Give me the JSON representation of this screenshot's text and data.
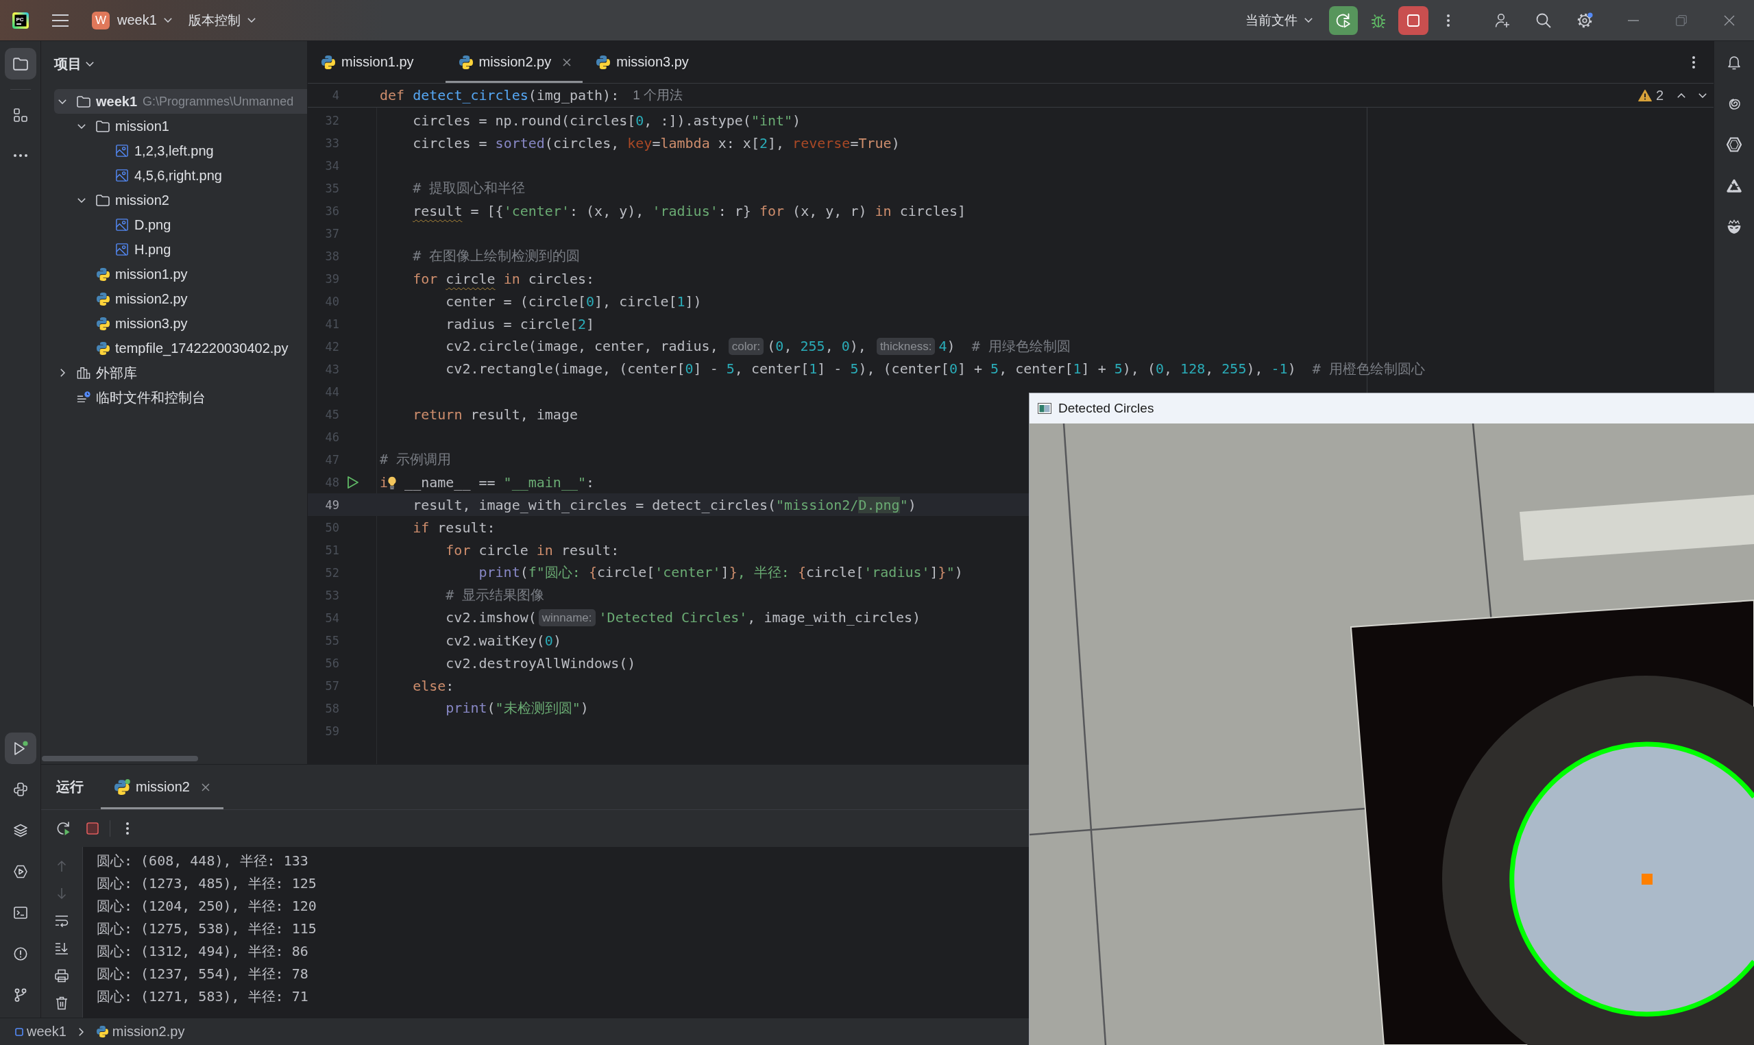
{
  "title_bar": {
    "logo": "PC",
    "project_initial": "W",
    "project": "week1",
    "vcs_menu": "版本控制",
    "run_config": "当前文件"
  },
  "tool_strip": {
    "top": [
      {
        "kind": "project",
        "selected": true
      },
      {
        "kind": "structure",
        "selected": false
      },
      {
        "kind": "more",
        "selected": false
      }
    ],
    "bottom": [
      {
        "kind": "run",
        "selected": true
      },
      {
        "kind": "python_console",
        "selected": false
      },
      {
        "kind": "packages",
        "selected": false
      },
      {
        "kind": "services",
        "selected": false
      },
      {
        "kind": "terminal",
        "selected": false
      },
      {
        "kind": "problems",
        "selected": false
      },
      {
        "kind": "git",
        "selected": false
      }
    ]
  },
  "project_panel": {
    "title": "项目",
    "tree": [
      {
        "kind": "folder",
        "name": "week1",
        "path": "G:\\Programmes\\Unmanned",
        "expanded": true,
        "selected": true,
        "children": [
          {
            "kind": "folder",
            "name": "mission1",
            "expanded": true,
            "selected": false,
            "children": [
              {
                "kind": "image",
                "name": "1,2,3,left.png",
                "selected": false
              },
              {
                "kind": "image",
                "name": "4,5,6,right.png",
                "selected": false
              }
            ]
          },
          {
            "kind": "folder",
            "name": "mission2",
            "expanded": true,
            "selected": false,
            "children": [
              {
                "kind": "image",
                "name": "D.png",
                "selected": false
              },
              {
                "kind": "image",
                "name": "H.png",
                "selected": false
              }
            ]
          },
          {
            "kind": "python",
            "name": "mission1.py",
            "selected": false
          },
          {
            "kind": "python",
            "name": "mission2.py",
            "selected": false
          },
          {
            "kind": "python",
            "name": "mission3.py",
            "selected": false
          },
          {
            "kind": "python",
            "name": "tempfile_1742220030402.py",
            "selected": false
          }
        ]
      },
      {
        "kind": "library",
        "name": "外部库",
        "expanded": false,
        "selected": false
      },
      {
        "kind": "scratches",
        "name": "临时文件和控制台",
        "selected": false
      }
    ]
  },
  "editor": {
    "tabs": [
      {
        "label": "mission1.py",
        "selected": false
      },
      {
        "label": "mission2.py",
        "selected": true
      },
      {
        "label": "mission3.py",
        "selected": false
      }
    ],
    "sticky_line": {
      "number": "4",
      "tokens": [
        {
          "kind": "keyword",
          "text": "def "
        },
        {
          "kind": "function",
          "text": "detect_circles"
        },
        {
          "kind": "plain",
          "text": "(img_path):"
        }
      ],
      "usages": "1 个用法"
    },
    "problems": "2",
    "lines": [
      {
        "n": "32",
        "current": false,
        "run_marker": false,
        "tokens": [
          {
            "kind": "plain",
            "text": "    circles = np.round(circles["
          },
          {
            "kind": "number",
            "text": "0"
          },
          {
            "kind": "plain",
            "text": ", :]).astype("
          },
          {
            "kind": "string",
            "text": "\"int\""
          },
          {
            "kind": "plain",
            "text": ")"
          }
        ]
      },
      {
        "n": "33",
        "current": false,
        "run_marker": false,
        "tokens": [
          {
            "kind": "plain",
            "text": "    circles = "
          },
          {
            "kind": "builtin",
            "text": "sorted"
          },
          {
            "kind": "plain",
            "text": "(circles, "
          },
          {
            "kind": "argument",
            "text": "key"
          },
          {
            "kind": "plain",
            "text": "="
          },
          {
            "kind": "keyword",
            "text": "lambda"
          },
          {
            "kind": "plain",
            "text": " x: x["
          },
          {
            "kind": "number",
            "text": "2"
          },
          {
            "kind": "plain",
            "text": "], "
          },
          {
            "kind": "argument",
            "text": "reverse"
          },
          {
            "kind": "plain",
            "text": "="
          },
          {
            "kind": "keyword",
            "text": "True"
          },
          {
            "kind": "plain",
            "text": ")"
          }
        ]
      },
      {
        "n": "34",
        "current": false,
        "run_marker": false
      },
      {
        "n": "35",
        "current": false,
        "run_marker": false,
        "tokens": [
          {
            "kind": "comment",
            "text": "    # 提取圆心和半径"
          }
        ]
      },
      {
        "n": "36",
        "current": false,
        "run_marker": false,
        "tokens": [
          {
            "kind": "warning",
            "text": "    result"
          },
          {
            "kind": "plain",
            "text": " = [{"
          },
          {
            "kind": "string",
            "text": "'center'"
          },
          {
            "kind": "plain",
            "text": ": (x, y), "
          },
          {
            "kind": "string",
            "text": "'radius'"
          },
          {
            "kind": "plain",
            "text": ": r} "
          },
          {
            "kind": "keyword",
            "text": "for"
          },
          {
            "kind": "plain",
            "text": " (x, y, r) "
          },
          {
            "kind": "keyword",
            "text": "in"
          },
          {
            "kind": "plain",
            "text": " circles]"
          }
        ]
      },
      {
        "n": "37",
        "current": false,
        "run_marker": false
      },
      {
        "n": "38",
        "current": false,
        "run_marker": false,
        "tokens": [
          {
            "kind": "comment",
            "text": "    # 在图像上绘制检测到的圆"
          }
        ]
      },
      {
        "n": "39",
        "current": false,
        "run_marker": false,
        "tokens": [
          {
            "kind": "keyword",
            "text": "    for "
          },
          {
            "kind": "warning",
            "text": "circle"
          },
          {
            "kind": "keyword",
            "text": " in"
          },
          {
            "kind": "plain",
            "text": " circles:"
          }
        ]
      },
      {
        "n": "40",
        "current": false,
        "run_marker": false,
        "tokens": [
          {
            "kind": "plain",
            "text": "        center = (circle["
          },
          {
            "kind": "number",
            "text": "0"
          },
          {
            "kind": "plain",
            "text": "], circle["
          },
          {
            "kind": "number",
            "text": "1"
          },
          {
            "kind": "plain",
            "text": "])"
          }
        ]
      },
      {
        "n": "41",
        "current": false,
        "run_marker": false,
        "tokens": [
          {
            "kind": "plain",
            "text": "        radius = circle["
          },
          {
            "kind": "number",
            "text": "2"
          },
          {
            "kind": "plain",
            "text": "]"
          }
        ]
      },
      {
        "n": "42",
        "current": false,
        "run_marker": false,
        "tokens": [
          {
            "kind": "plain",
            "text": "        cv2.circle(image, center, radius, "
          },
          {
            "kind": "hint",
            "text": "color:"
          },
          {
            "kind": "plain",
            "text": "("
          },
          {
            "kind": "number",
            "text": "0"
          },
          {
            "kind": "plain",
            "text": ", "
          },
          {
            "kind": "number",
            "text": "255"
          },
          {
            "kind": "plain",
            "text": ", "
          },
          {
            "kind": "number",
            "text": "0"
          },
          {
            "kind": "plain",
            "text": "), "
          },
          {
            "kind": "hint",
            "text": "thickness:"
          },
          {
            "kind": "number",
            "text": "4"
          },
          {
            "kind": "plain",
            "text": ")  "
          },
          {
            "kind": "comment",
            "text": "# 用绿色绘制圆"
          }
        ]
      },
      {
        "n": "43",
        "current": false,
        "run_marker": false,
        "tokens": [
          {
            "kind": "plain",
            "text": "        cv2.rectangle(image, (center["
          },
          {
            "kind": "number",
            "text": "0"
          },
          {
            "kind": "plain",
            "text": "] - "
          },
          {
            "kind": "number",
            "text": "5"
          },
          {
            "kind": "plain",
            "text": ", center["
          },
          {
            "kind": "number",
            "text": "1"
          },
          {
            "kind": "plain",
            "text": "] - "
          },
          {
            "kind": "number",
            "text": "5"
          },
          {
            "kind": "plain",
            "text": "), (center["
          },
          {
            "kind": "number",
            "text": "0"
          },
          {
            "kind": "plain",
            "text": "] + "
          },
          {
            "kind": "number",
            "text": "5"
          },
          {
            "kind": "plain",
            "text": ", center["
          },
          {
            "kind": "number",
            "text": "1"
          },
          {
            "kind": "plain",
            "text": "] + "
          },
          {
            "kind": "number",
            "text": "5"
          },
          {
            "kind": "plain",
            "text": "), ("
          },
          {
            "kind": "number",
            "text": "0"
          },
          {
            "kind": "plain",
            "text": ", "
          },
          {
            "kind": "number",
            "text": "128"
          },
          {
            "kind": "plain",
            "text": ", "
          },
          {
            "kind": "number",
            "text": "255"
          },
          {
            "kind": "plain",
            "text": "), "
          },
          {
            "kind": "number",
            "text": "-1"
          },
          {
            "kind": "plain",
            "text": ")  "
          },
          {
            "kind": "comment",
            "text": "# 用橙色绘制圆心"
          }
        ]
      },
      {
        "n": "44",
        "current": false,
        "run_marker": false
      },
      {
        "n": "45",
        "current": false,
        "run_marker": false,
        "tokens": [
          {
            "kind": "keyword",
            "text": "    return"
          },
          {
            "kind": "plain",
            "text": " result, image"
          }
        ]
      },
      {
        "n": "46",
        "current": false,
        "run_marker": false
      },
      {
        "n": "47",
        "current": false,
        "run_marker": false,
        "tokens": [
          {
            "kind": "comment",
            "text": "# 示例调用"
          }
        ]
      },
      {
        "n": "48",
        "current": false,
        "run_marker": true,
        "tokens": [
          {
            "kind": "keyword",
            "text": "i"
          },
          {
            "kind": "bulb"
          },
          {
            "kind": "plain",
            "text": " __name__ == "
          },
          {
            "kind": "string",
            "text": "\"__main__\""
          },
          {
            "kind": "plain",
            "text": ":"
          }
        ]
      },
      {
        "n": "49",
        "current": true,
        "run_marker": false,
        "tokens": [
          {
            "kind": "plain",
            "text": "    result, image_with_circles = detect_circles("
          },
          {
            "kind": "string",
            "text": "\"mission2/"
          },
          {
            "kind": "match",
            "text": "D.png"
          },
          {
            "kind": "string",
            "text": "\""
          },
          {
            "kind": "plain",
            "text": ")"
          }
        ]
      },
      {
        "n": "50",
        "current": false,
        "run_marker": false,
        "tokens": [
          {
            "kind": "keyword",
            "text": "    if"
          },
          {
            "kind": "plain",
            "text": " result:"
          }
        ]
      },
      {
        "n": "51",
        "current": false,
        "run_marker": false,
        "tokens": [
          {
            "kind": "keyword",
            "text": "        for"
          },
          {
            "kind": "plain",
            "text": " circle "
          },
          {
            "kind": "keyword",
            "text": "in"
          },
          {
            "kind": "plain",
            "text": " result:"
          }
        ]
      },
      {
        "n": "52",
        "current": false,
        "run_marker": false,
        "tokens": [
          {
            "kind": "builtin",
            "text": "            print"
          },
          {
            "kind": "plain",
            "text": "("
          },
          {
            "kind": "string",
            "text": "f\"圆心: "
          },
          {
            "kind": "keyword",
            "text": "{"
          },
          {
            "kind": "plain",
            "text": "circle["
          },
          {
            "kind": "string",
            "text": "'center'"
          },
          {
            "kind": "plain",
            "text": "]"
          },
          {
            "kind": "keyword",
            "text": "}"
          },
          {
            "kind": "string",
            "text": ", 半径: "
          },
          {
            "kind": "keyword",
            "text": "{"
          },
          {
            "kind": "plain",
            "text": "circle["
          },
          {
            "kind": "string",
            "text": "'radius'"
          },
          {
            "kind": "plain",
            "text": "]"
          },
          {
            "kind": "keyword",
            "text": "}"
          },
          {
            "kind": "string",
            "text": "\""
          },
          {
            "kind": "plain",
            "text": ")"
          }
        ]
      },
      {
        "n": "53",
        "current": false,
        "run_marker": false,
        "tokens": [
          {
            "kind": "comment",
            "text": "        # 显示结果图像"
          }
        ]
      },
      {
        "n": "54",
        "current": false,
        "run_marker": false,
        "tokens": [
          {
            "kind": "plain",
            "text": "        cv2.imshow("
          },
          {
            "kind": "hint",
            "text": "winname:"
          },
          {
            "kind": "string",
            "text": "'Detected Circles'"
          },
          {
            "kind": "plain",
            "text": ", image_with_circles)"
          }
        ]
      },
      {
        "n": "55",
        "current": false,
        "run_marker": false,
        "tokens": [
          {
            "kind": "plain",
            "text": "        cv2.waitKey("
          },
          {
            "kind": "number",
            "text": "0"
          },
          {
            "kind": "plain",
            "text": ")"
          }
        ]
      },
      {
        "n": "56",
        "current": false,
        "run_marker": false,
        "tokens": [
          {
            "kind": "plain",
            "text": "        cv2.destroyAllWindows()"
          }
        ]
      },
      {
        "n": "57",
        "current": false,
        "run_marker": false,
        "tokens": [
          {
            "kind": "keyword",
            "text": "    else"
          },
          {
            "kind": "plain",
            "text": ":"
          }
        ]
      },
      {
        "n": "58",
        "current": false,
        "run_marker": false,
        "tokens": [
          {
            "kind": "builtin",
            "text": "        print"
          },
          {
            "kind": "plain",
            "text": "("
          },
          {
            "kind": "string",
            "text": "\"未检测到圆\""
          },
          {
            "kind": "plain",
            "text": ")"
          }
        ]
      },
      {
        "n": "59",
        "current": false,
        "run_marker": false
      }
    ]
  },
  "run_panel": {
    "title": "运行",
    "tabs": [
      {
        "label": "mission2",
        "selected": true
      }
    ],
    "output": [
      "圆心: (608, 448), 半径: 133",
      "圆心: (1273, 485), 半径: 125",
      "圆心: (1204, 250), 半径: 120",
      "圆心: (1275, 538), 半径: 115",
      "圆心: (1312, 494), 半径: 86",
      "圆心: (1237, 554), 半径: 78",
      "圆心: (1271, 583), 半径: 71"
    ]
  },
  "status_bar": {
    "breadcrumbs": [
      {
        "kind": "module",
        "label": "week1"
      },
      {
        "kind": "python",
        "label": "mission2.py"
      }
    ]
  },
  "image_window": {
    "title": "Detected Circles"
  }
}
